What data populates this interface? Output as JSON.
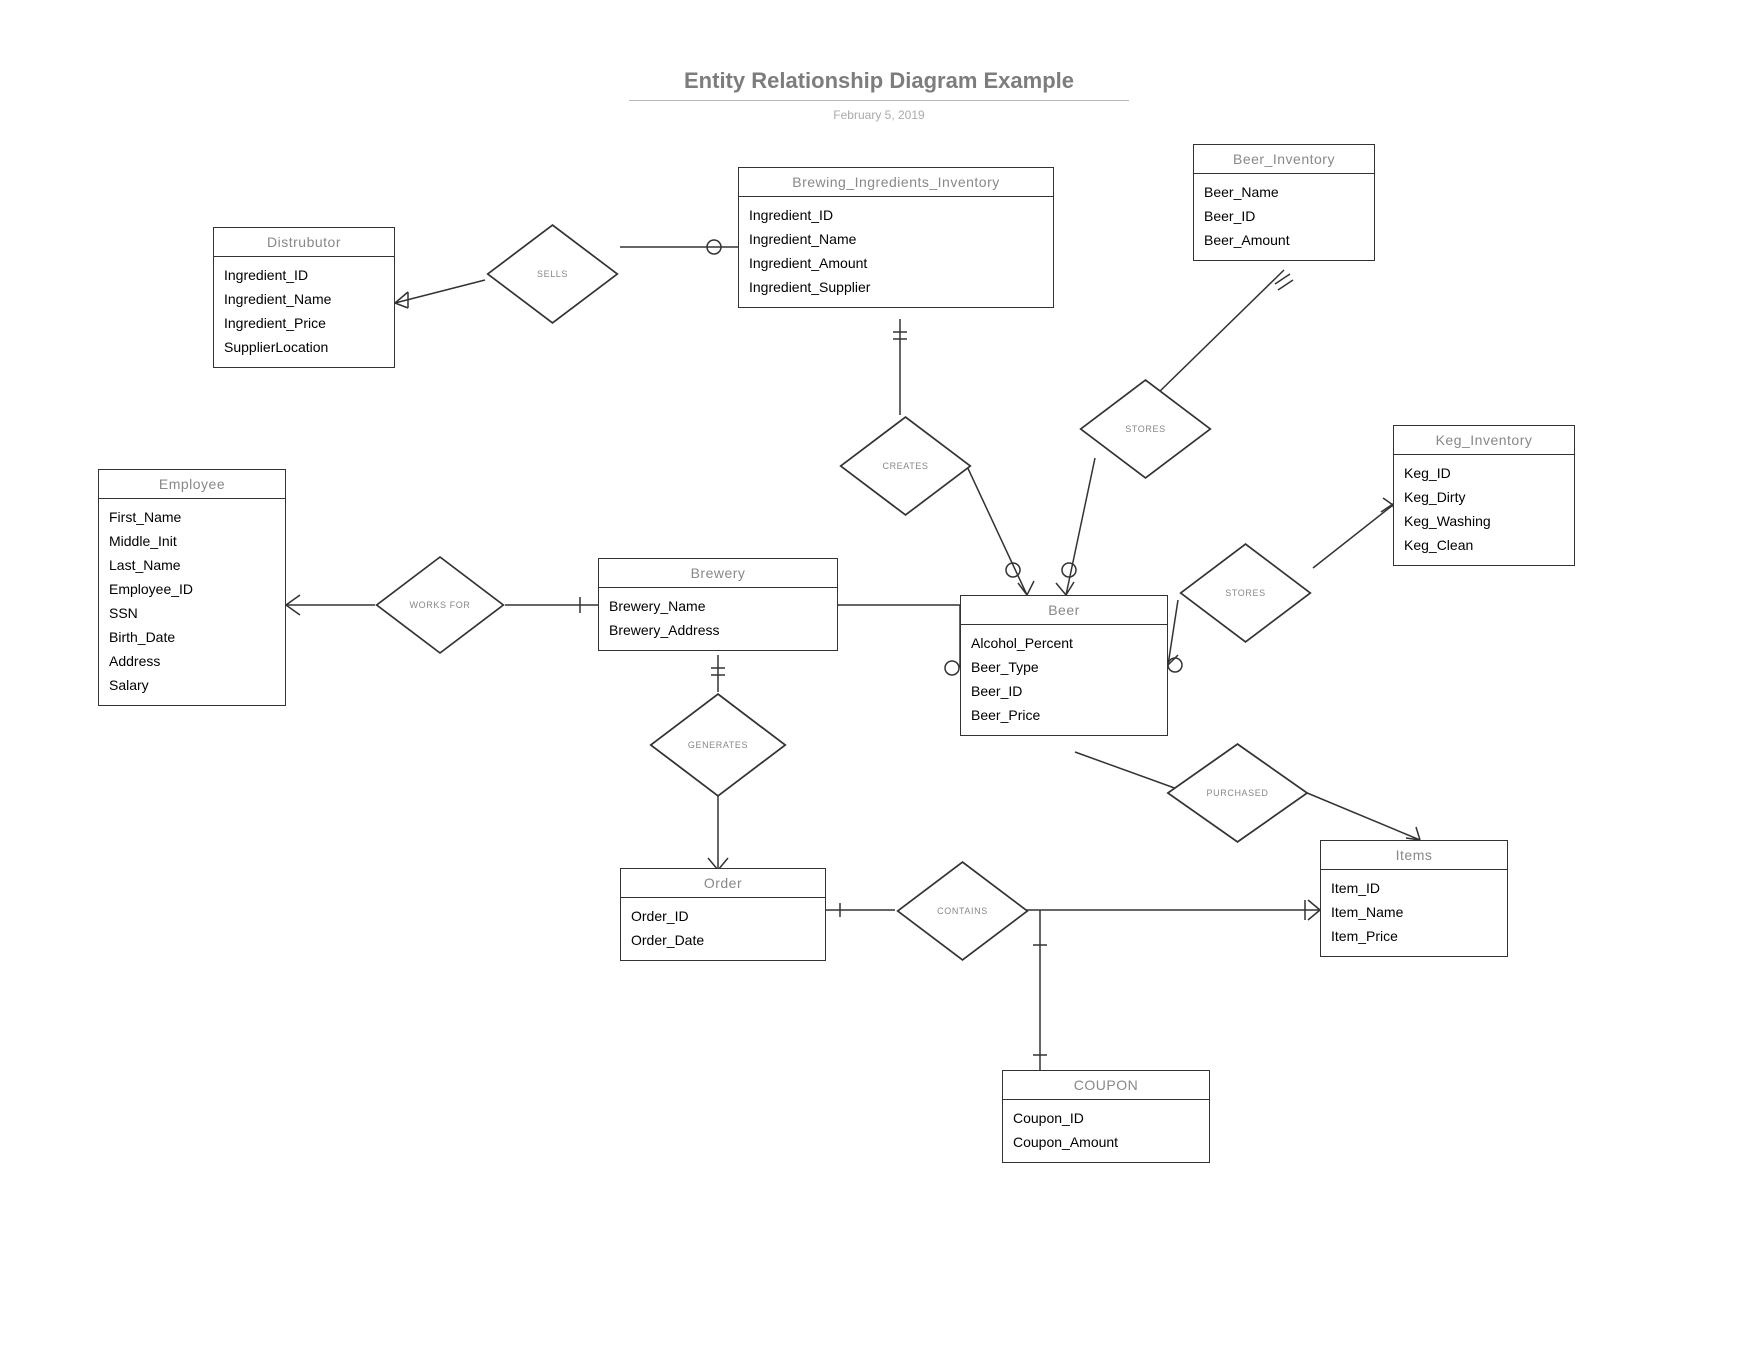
{
  "title": "Entity Relationship Diagram Example",
  "date": "February 5, 2019",
  "entities": {
    "distributor": {
      "name": "Distrubutor",
      "attributes": [
        "Ingredient_ID",
        "Ingredient_Name",
        "Ingredient_Price",
        "SupplierLocation"
      ]
    },
    "brewing_ingredients_inventory": {
      "name": "Brewing_Ingredients_Inventory",
      "attributes": [
        "Ingredient_ID",
        "Ingredient_Name",
        "Ingredient_Amount",
        "Ingredient_Supplier"
      ]
    },
    "beer_inventory": {
      "name": "Beer_Inventory",
      "attributes": [
        "Beer_Name",
        "Beer_ID",
        "Beer_Amount"
      ]
    },
    "keg_inventory": {
      "name": "Keg_Inventory",
      "attributes": [
        "Keg_ID",
        "Keg_Dirty",
        "Keg_Washing",
        "Keg_Clean"
      ]
    },
    "employee": {
      "name": "Employee",
      "attributes": [
        "First_Name",
        "Middle_Init",
        "Last_Name",
        "Employee_ID",
        "SSN",
        "Birth_Date",
        "Address",
        "Salary"
      ]
    },
    "brewery": {
      "name": "Brewery",
      "attributes": [
        "Brewery_Name",
        "Brewery_Address"
      ]
    },
    "beer": {
      "name": "Beer",
      "attributes": [
        "Alcohol_Percent",
        "Beer_Type",
        "Beer_ID",
        "Beer_Price"
      ]
    },
    "order": {
      "name": "Order",
      "attributes": [
        "Order_ID",
        "Order_Date"
      ]
    },
    "items": {
      "name": "Items",
      "attributes": [
        "Item_ID",
        "Item_Name",
        "Item_Price"
      ]
    },
    "coupon": {
      "name": "COUPON",
      "attributes": [
        "Coupon_ID",
        "Coupon_Amount"
      ]
    }
  },
  "relationships": {
    "sells": "SELLS",
    "creates": "CREATES",
    "stores1": "STORES",
    "stores2": "STORES",
    "works_for": "WORKS FOR",
    "generates": "GENERATES",
    "purchased": "PURCHASED",
    "contains": "CONTAINS"
  }
}
